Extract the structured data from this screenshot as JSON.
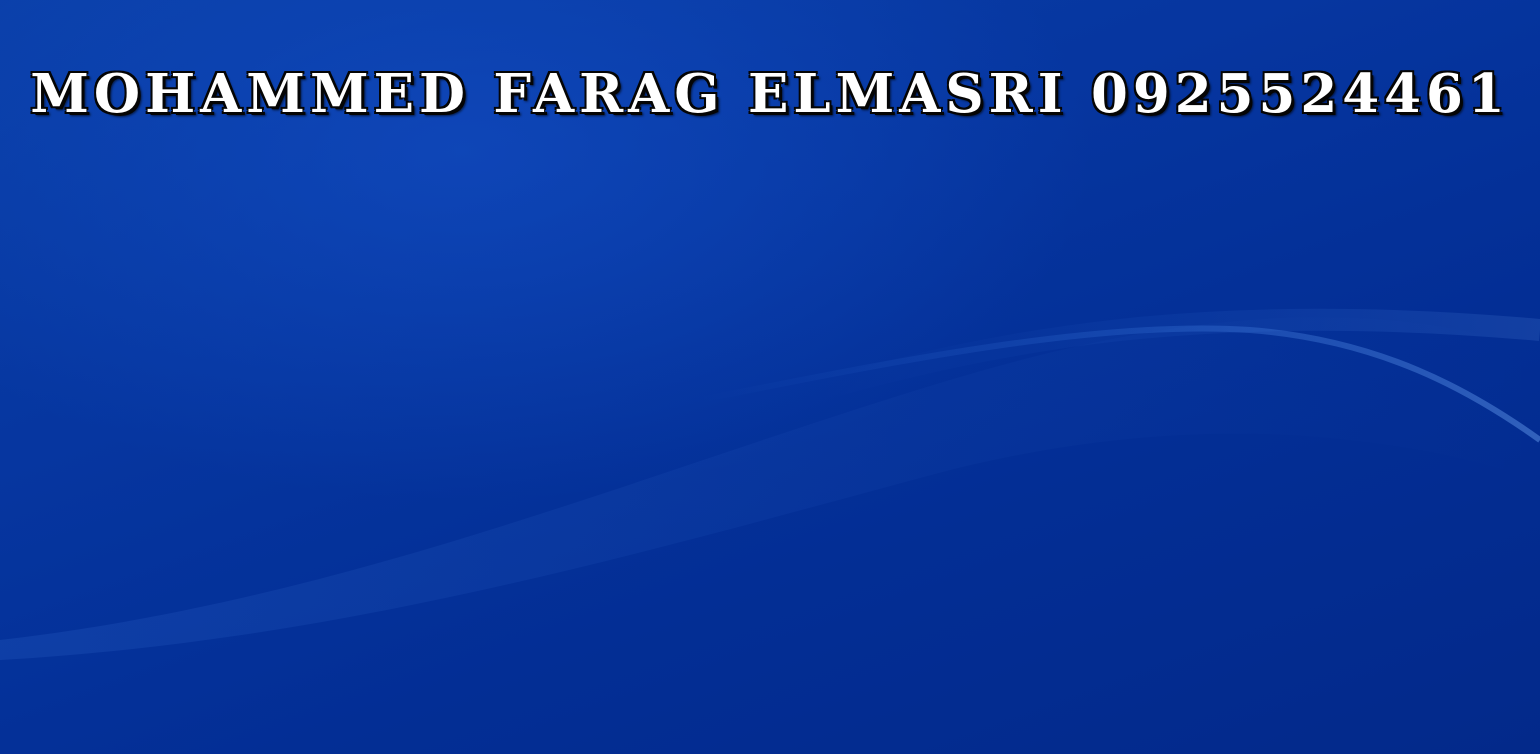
{
  "banner": {
    "text": "MOHAMMED FARAG ELMASRI 0925524461"
  },
  "wallpaper": {
    "base_color": "#0636a0",
    "wave_color": "#2a6ad8"
  }
}
